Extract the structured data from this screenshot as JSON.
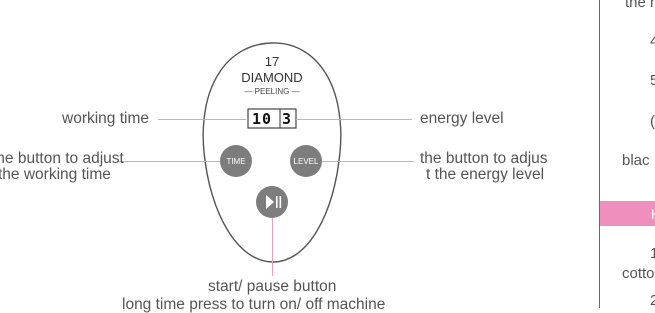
{
  "device": {
    "model_number": "17",
    "model_name": "DIAMOND",
    "model_sub": "— PEELING —",
    "display_digits": "10 3",
    "time_button": "TIME",
    "level_button": "LEVEL",
    "play_pause_icon": "play-pause-icon"
  },
  "labels": {
    "working_time": "working time",
    "energy_level": "energy level",
    "adjust_time_line1": "the button to adjust",
    "adjust_time_line2": "the working time",
    "adjust_energy_line1": "the button to adjus",
    "adjust_energy_line2": "t the energy level",
    "start_pause_line1": "start/ pause button",
    "start_pause_line2": "long time press to turn on/ off machine"
  },
  "right_panel": {
    "line1": "the m",
    "line2": "4",
    "line3": "5",
    "line4": "(",
    "line5": "blac",
    "bar_text": "H",
    "line6": "1",
    "line7": "cotto",
    "line8": "2"
  },
  "colors": {
    "leader": "#e6a2b8",
    "button": "#7d7d7d",
    "accent_bar": "#ee8fbd",
    "text": "#555555"
  }
}
